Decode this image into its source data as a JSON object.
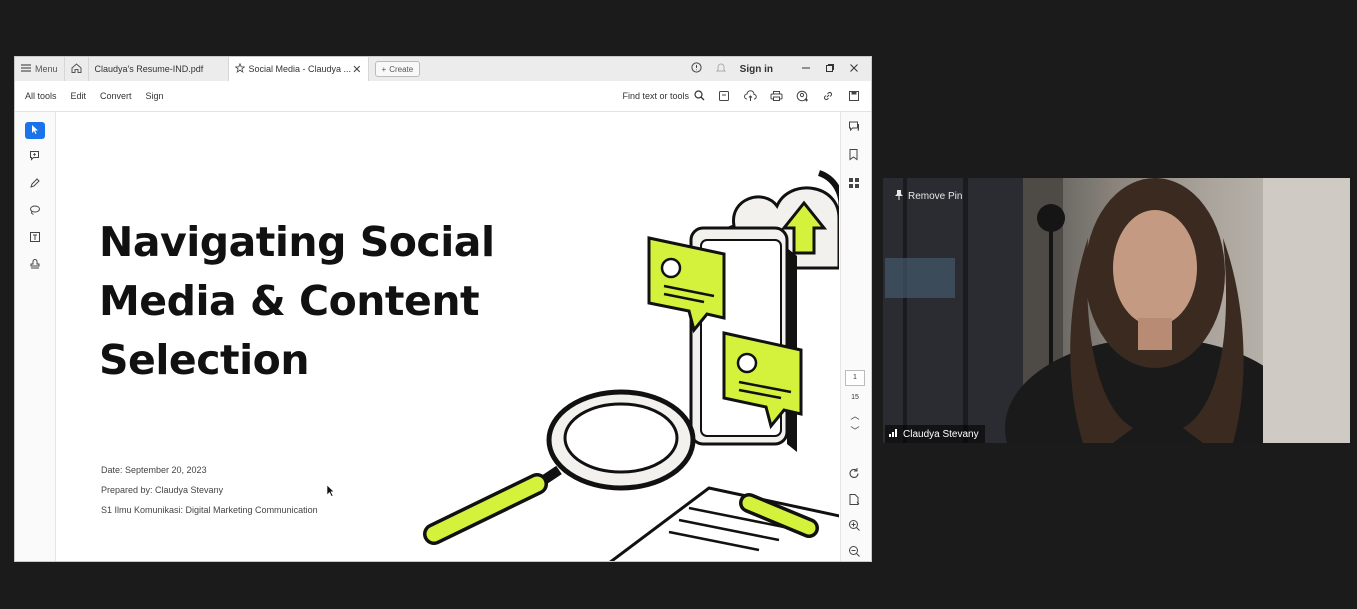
{
  "window": {
    "menu_label": "Menu",
    "tabs": [
      {
        "label": "Claudya's Resume-IND.pdf"
      },
      {
        "label": "Social Media - Claudya ..."
      }
    ],
    "create_label": "Create",
    "sign_in_label": "Sign in"
  },
  "toolbar": {
    "menu_items": [
      "All tools",
      "Edit",
      "Convert",
      "Sign"
    ],
    "find_label": "Find text or tools"
  },
  "page_nav": {
    "current": "1",
    "total": "15"
  },
  "slide": {
    "title_lines": [
      "Navigating Social",
      "Media & Content",
      "Selection"
    ],
    "date": "Date: September 20, 2023",
    "prepared_by": "Prepared by: Claudya Stevany",
    "program": "S1 Ilmu Komunikasi: Digital Marketing Communication"
  },
  "video": {
    "pin_label": "Remove Pin",
    "participant_name": "Claudya Stevany"
  },
  "colors": {
    "accent_green": "#d4f23b",
    "app_blue": "#1a73e8",
    "meeting_bg": "#1b1b1b"
  }
}
